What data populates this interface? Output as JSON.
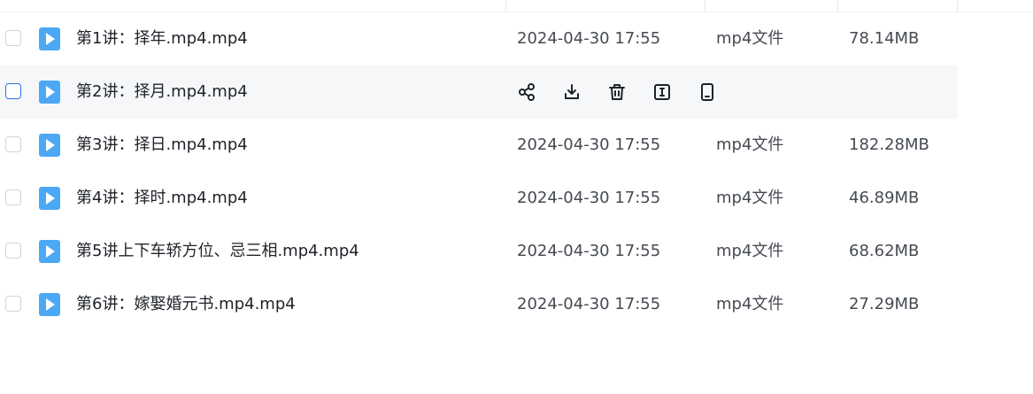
{
  "files": [
    {
      "name": "第1讲：择年.mp4.mp4",
      "date": "2024-04-30 17:55",
      "type": "mp4文件",
      "size": "78.14MB"
    },
    {
      "name": "第2讲：择月.mp4.mp4",
      "date": "",
      "type": "",
      "size": ""
    },
    {
      "name": "第3讲：择日.mp4.mp4",
      "date": "2024-04-30 17:55",
      "type": "mp4文件",
      "size": "182.28MB"
    },
    {
      "name": "第4讲：择时.mp4.mp4",
      "date": "2024-04-30 17:55",
      "type": "mp4文件",
      "size": "46.89MB"
    },
    {
      "name": "第5讲上下车轿方位、忌三相.mp4.mp4",
      "date": "2024-04-30 17:55",
      "type": "mp4文件",
      "size": "68.62MB"
    },
    {
      "name": "第6讲：嫁娶婚元书.mp4.mp4",
      "date": "2024-04-30 17:55",
      "type": "mp4文件",
      "size": "27.29MB"
    }
  ],
  "hover_actions": [
    "share-icon",
    "download-icon",
    "delete-icon",
    "rename-icon",
    "phone-icon"
  ],
  "colors": {
    "file_icon": "#4aa8f5",
    "checkbox_active": "#2b6ff0",
    "hover_bg": "#f6f7f9"
  }
}
